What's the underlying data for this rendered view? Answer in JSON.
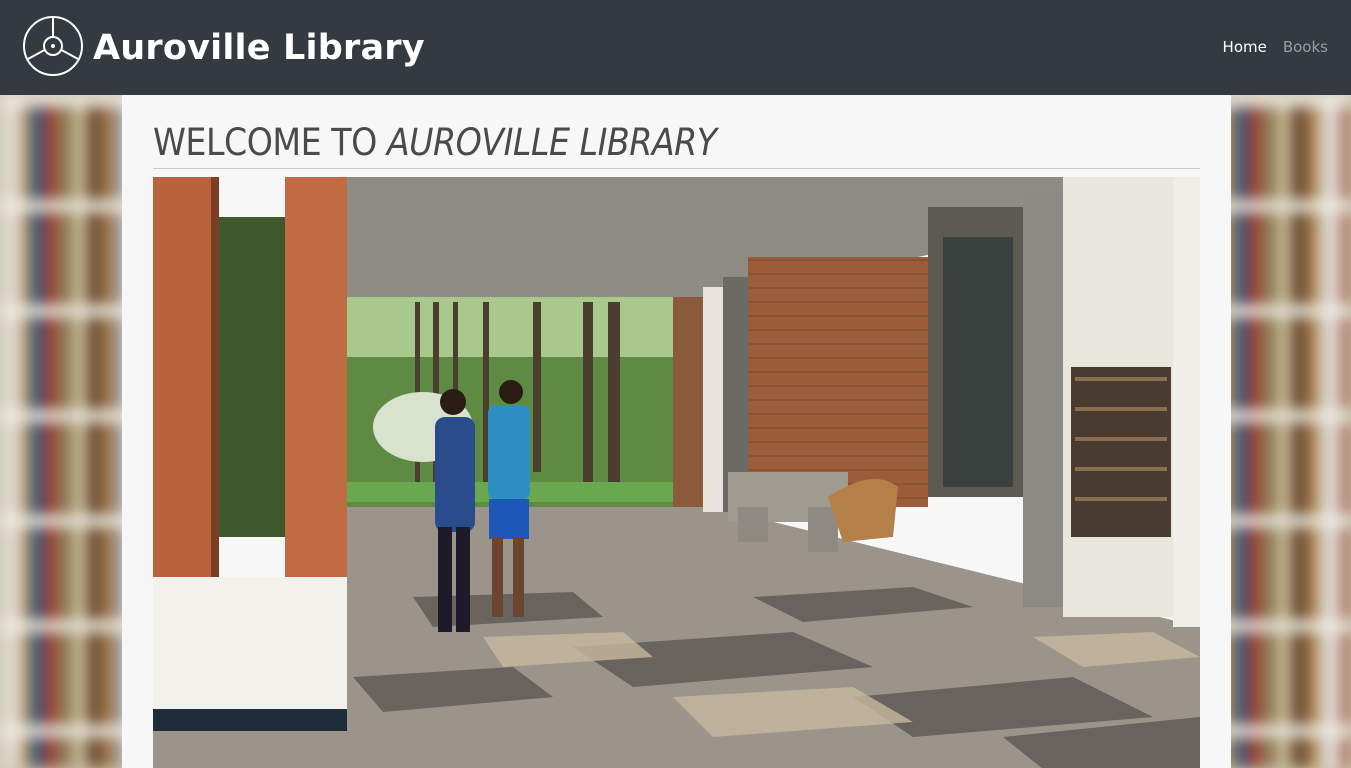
{
  "navbar": {
    "brand_name": "Auroville Library",
    "logo_icon": "auroville-emblem-icon",
    "links": [
      {
        "label": "Home",
        "active": true
      },
      {
        "label": "Books",
        "active": false
      }
    ]
  },
  "main": {
    "title_prefix": "WELCOME TO ",
    "title_emphasis": "AUROVILLE LIBRARY",
    "hero_image": "library-entrance-photo"
  },
  "colors": {
    "navbar_bg": "#343a40",
    "content_bg": "#f7f7f8",
    "title_text": "#4a4a4a"
  }
}
